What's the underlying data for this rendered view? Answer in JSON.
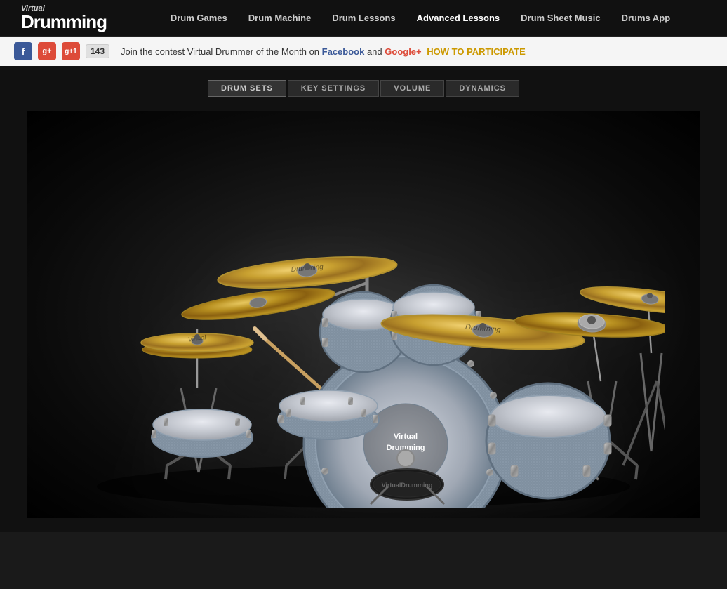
{
  "header": {
    "logo_virtual": "Virtual",
    "logo_drumming": "Drumming",
    "nav_items": [
      {
        "label": "Drum Games",
        "href": "#"
      },
      {
        "label": "Drum Machine",
        "href": "#"
      },
      {
        "label": "Drum Lessons",
        "href": "#"
      },
      {
        "label": "Advanced Lessons",
        "href": "#",
        "active": true
      },
      {
        "label": "Drum Sheet Music",
        "href": "#"
      },
      {
        "label": "Drums App",
        "href": "#"
      }
    ]
  },
  "social_bar": {
    "fb_label": "f",
    "gplus_label": "g+",
    "g1_label": "g+1",
    "count": "143",
    "text_prefix": "Join the contest Virtual Drummer of the Month on",
    "fb_link": "Facebook",
    "text_middle": "and",
    "gp_link": "Google+",
    "how_to": "HOW TO PARTICIPATE"
  },
  "tabs": [
    {
      "label": "DRUM SETS",
      "active": true
    },
    {
      "label": "KEY SETTINGS"
    },
    {
      "label": "VOLUME"
    },
    {
      "label": "DYNAMICS"
    }
  ],
  "drum_brand": "VirtualDrumming",
  "stool_label": "VirtualDrumming"
}
